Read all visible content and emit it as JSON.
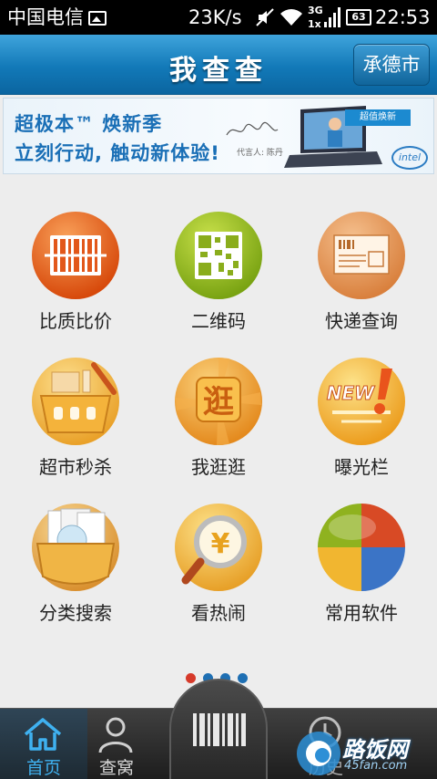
{
  "statusbar": {
    "carrier": "中国电信",
    "speed": "23K/s",
    "network": "3G",
    "battery": "63",
    "time": "22:53"
  },
  "header": {
    "title": "我查查",
    "city": "承德市"
  },
  "banner": {
    "line1": "超极本™ 焕新季",
    "line2": "立刻行动, 触动新体验!",
    "spokesperson": "代言人: 陈丹",
    "tag": "超值焕新",
    "brand": "intel"
  },
  "grid": [
    {
      "label": "比质比价",
      "icon": "barcode-icon",
      "color": "#e8631a"
    },
    {
      "label": "二维码",
      "icon": "qrcode-icon",
      "color": "#8cb51c"
    },
    {
      "label": "快递查询",
      "icon": "express-package-icon",
      "color": "#e8955a"
    },
    {
      "label": "超市秒杀",
      "icon": "shopping-basket-icon",
      "color": "#f3b23c"
    },
    {
      "label": "我逛逛",
      "icon": "browse-icon",
      "color": "#f0a030"
    },
    {
      "label": "曝光栏",
      "icon": "new-exposure-icon",
      "color": "#f6b63b"
    },
    {
      "label": "分类搜索",
      "icon": "category-folder-icon",
      "color": "#e8a848"
    },
    {
      "label": "看热闹",
      "icon": "money-magnifier-icon",
      "color": "#f0b540"
    },
    {
      "label": "常用软件",
      "icon": "apps-pie-icon",
      "color": "#3a76c5"
    }
  ],
  "browse_glyph": "逛",
  "new_glyph": "NEW",
  "pager": {
    "count": 4,
    "active": 0,
    "active_color": "#d63a2a",
    "color": "#1e6fb3"
  },
  "tabs": {
    "home": "首页",
    "chawo": "查窝",
    "history": "历史"
  },
  "watermark": {
    "name": "路饭网",
    "url": "45fan.com"
  }
}
